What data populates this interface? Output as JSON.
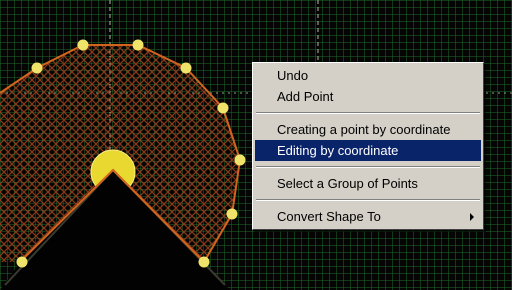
{
  "colors": {
    "background": "#050505",
    "grid": "#1f6b2c",
    "shape_outline": "#d2641e",
    "shape_hatch": "#8a3a1a",
    "control_point": "#f0e36a",
    "menu_bg": "#d4d0c8",
    "menu_highlight": "#0a246a"
  },
  "context_menu": {
    "items": [
      {
        "label": "Undo",
        "highlighted": false,
        "submenu": false
      },
      {
        "label": "Add Point",
        "highlighted": false,
        "submenu": false
      },
      {
        "separator": true
      },
      {
        "label": "Creating a point by coordinate",
        "highlighted": false,
        "submenu": false
      },
      {
        "label": "Editing by coordinate",
        "highlighted": true,
        "submenu": false
      },
      {
        "separator": true
      },
      {
        "label": "Select a Group of Points",
        "highlighted": false,
        "submenu": false
      },
      {
        "separator": true
      },
      {
        "label": "Convert Shape To",
        "highlighted": false,
        "submenu": true,
        "submenu_icon": "chevron-right-icon"
      }
    ]
  }
}
